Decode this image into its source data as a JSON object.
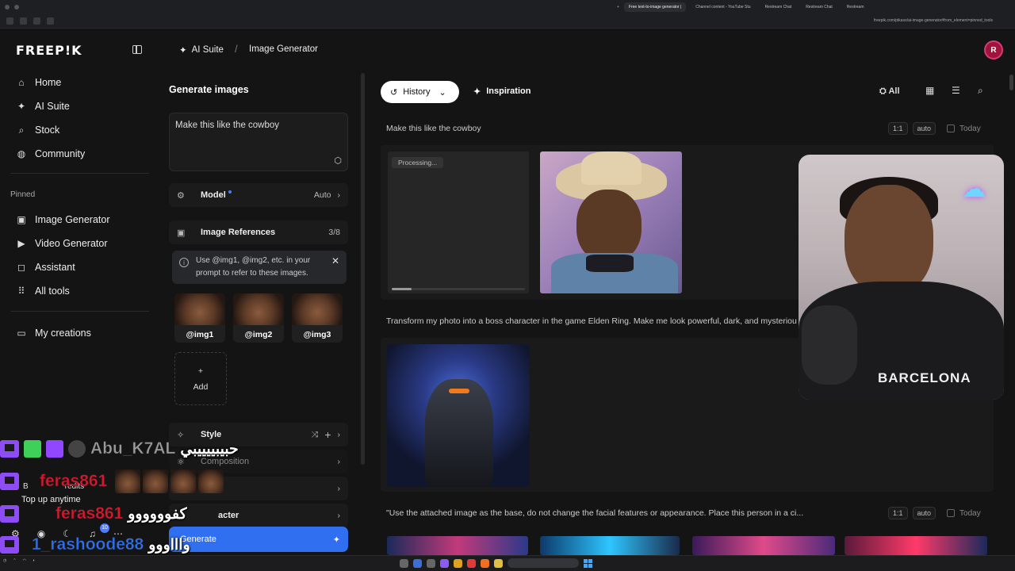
{
  "browser": {
    "tabs": [
      "Free text-to-image generator |",
      "Channel content - YouTube Stu",
      "Restream Chat",
      "Restream Chat",
      "Restream"
    ],
    "url": "freepik.com/pikaso/ai-image-generator#from_element=pinned_tools"
  },
  "sidebar": {
    "logo": "FREEP!K",
    "items": [
      {
        "label": "Home",
        "icon": "home-icon",
        "glyph": "⌂"
      },
      {
        "label": "AI Suite",
        "icon": "sparkle-icon",
        "glyph": "✦"
      },
      {
        "label": "Stock",
        "icon": "search-icon",
        "glyph": "⌕"
      },
      {
        "label": "Community",
        "icon": "globe-icon",
        "glyph": "◍"
      }
    ],
    "pinned_label": "Pinned",
    "pinned": [
      {
        "label": "Image Generator",
        "icon": "image-icon",
        "glyph": "▣"
      },
      {
        "label": "Video Generator",
        "icon": "video-icon",
        "glyph": "▶"
      },
      {
        "label": "Assistant",
        "icon": "chat-icon",
        "glyph": "◻"
      },
      {
        "label": "All tools",
        "icon": "grid-icon",
        "glyph": "⠿"
      }
    ],
    "my_creations": {
      "label": "My creations",
      "icon": "folder-icon",
      "glyph": "▭"
    },
    "credits_prefix": "B",
    "credits_suffix": "redits",
    "top_up": "Top up anytime",
    "notification_count": "10"
  },
  "header": {
    "ai_suite": "AI Suite",
    "page": "Image Generator",
    "avatar_letter": "R"
  },
  "panel": {
    "title": "Generate images",
    "prompt": "Make this like the cowboy",
    "model_label": "Model",
    "model_value": "Auto",
    "refs_label": "Image References",
    "refs_count": "3/8",
    "info_text": "Use @img1, @img2, etc. in your prompt to refer to these images.",
    "thumbs": [
      "@img1",
      "@img2",
      "@img3"
    ],
    "add_label": "Add",
    "style_label": "Style",
    "composition_label": "Composition",
    "e_label": "E",
    "character_label": "acter",
    "generate_label": "Generate"
  },
  "main": {
    "history_label": "History",
    "inspiration_label": "Inspiration",
    "all_label": "All",
    "entries": [
      {
        "prompt": "Make this like the cowboy",
        "ratio": "1:1",
        "mode": "auto",
        "date": "Today",
        "processing": "Processing..."
      },
      {
        "prompt": "Transform my photo into a boss character in the game Elden Ring. Make me look powerful, dark, and mysteriou"
      },
      {
        "prompt": "\"Use the attached image as the base, do not change the facial features or appearance. Place this person in a ci...",
        "ratio": "1:1",
        "mode": "auto",
        "date": "Today"
      }
    ]
  },
  "webcam": {
    "shirt_text": "BARCELONA"
  },
  "chat": [
    {
      "name": "Abu_K7AL",
      "message": "حبيبييييبي",
      "color": "#9a9a9a"
    },
    {
      "name": "feras861",
      "message": "",
      "color": "#e0142a"
    },
    {
      "name": "feras861",
      "message": "كفوووووو",
      "color": "#e0142a"
    },
    {
      "name": "1_rashoode88",
      "message": "واااووو",
      "color": "#2a6ff5"
    }
  ]
}
